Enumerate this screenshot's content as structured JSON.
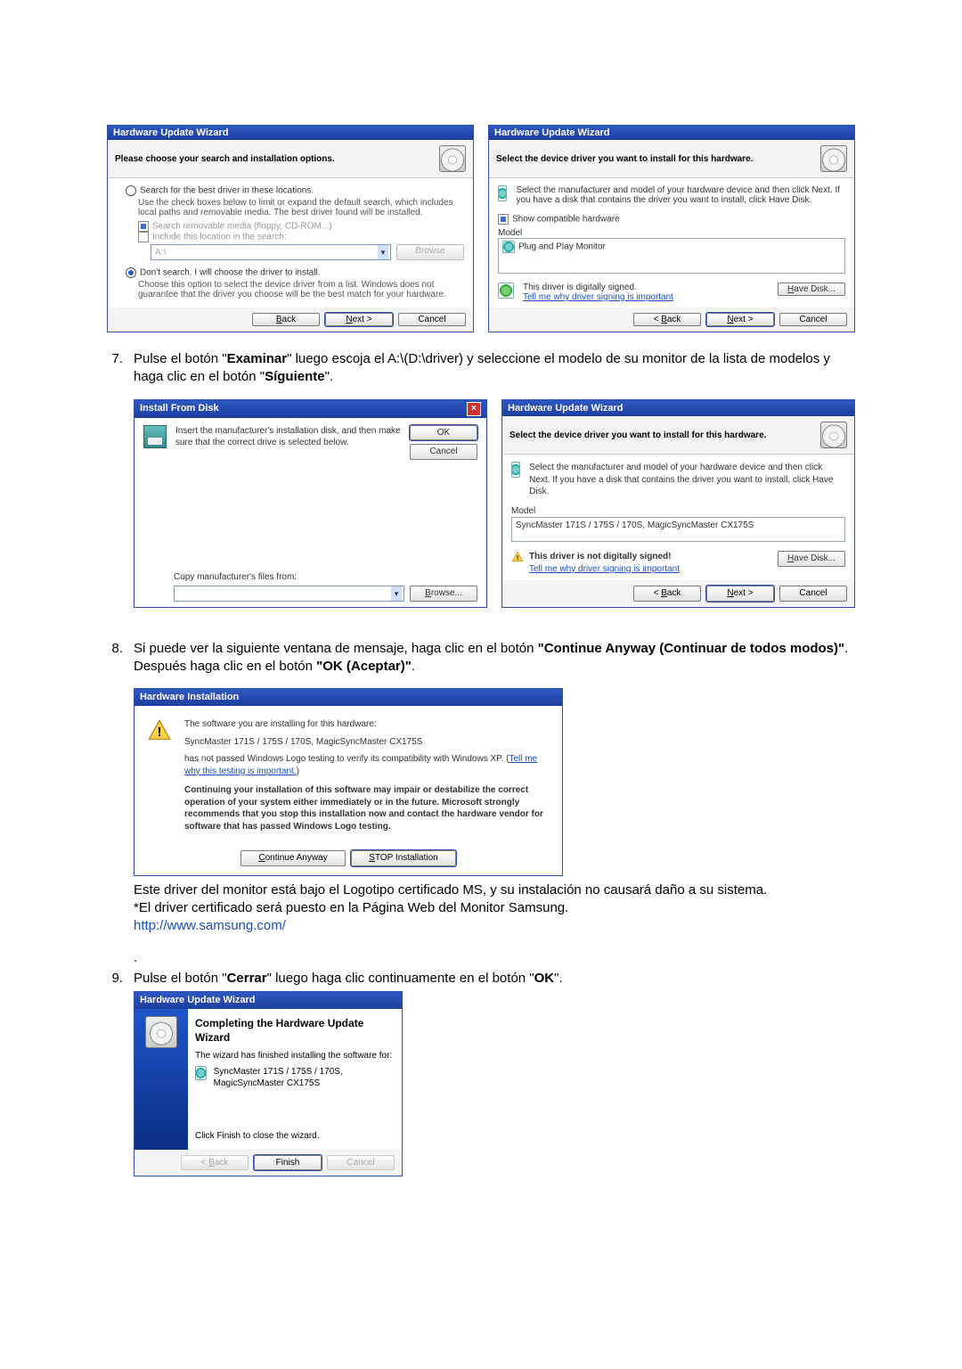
{
  "wizard_title": "Hardware Update Wizard",
  "install_from_disk_title": "Install From Disk",
  "hw_installation_title": "Hardware Installation",
  "search_header": "Please choose your search and installation options.",
  "search_radio1": "Search for the best driver in these locations.",
  "search_desc": "Use the check boxes below to limit or expand the default search, which includes local paths and removable media. The best driver found will be installed.",
  "search_chk1": "Search removable media (floppy, CD-ROM...)",
  "search_chk2": "Include this location in the search:",
  "search_path": "A:\\",
  "search_radio2": "Don't search. I will choose the driver to install.",
  "search_desc2": "Choose this option to select the device driver from a list.  Windows does not guarantee that the driver you choose will be the best match for your hardware.",
  "select_header": "Select the device driver you want to install for this hardware.",
  "select_desc": "Select the manufacturer and model of your hardware device and then click Next. If you have a disk that contains the driver you want to install, click Have Disk.",
  "show_compat": "Show compatible hardware",
  "model_label": "Model",
  "model_pnp": "Plug and Play Monitor",
  "signed_text": "This driver is digitally signed.",
  "unsigned_text": "This driver is not digitally signed!",
  "tell_me_why": "Tell me why driver signing is important",
  "model_sync": "SyncMaster 171S / 175S / 170S, MagicSyncMaster CX175S",
  "ifd_insert": "Insert the manufacturer's installation disk, and then make sure that the correct drive is selected below.",
  "ifd_copy": "Copy manufacturer's files from:",
  "btn_back": "< Back",
  "btn_next": "Next >",
  "btn_cancel": "Cancel",
  "btn_ok": "OK",
  "btn_browse": "Browse...",
  "btn_browse_u": "Browse",
  "btn_have_disk": "Have Disk...",
  "btn_finish": "Finish",
  "btn_continue_anyway": "Continue Anyway",
  "btn_stop_install": "STOP Installation",
  "step7_pre": "Pulse el botón \"",
  "step7_b1": "Examinar",
  "step7_mid": "\" luego escoja el A:\\(D:\\driver) y seleccione el modelo de su monitor de la lista de modelos y haga clic en el botón \"",
  "step7_b2": "Síguiente",
  "step7_post": "\".",
  "num7": "7.",
  "step8_pre": "Si puede ver la siguiente ventana de mensaje, haga clic en el botón ",
  "step8_b1": "\"Continue Anyway (Continuar de todos modos)\"",
  "step8_mid": ". Después haga clic en el botón ",
  "step8_b2": "\"OK (Aceptar)\"",
  "step8_post": ".",
  "num8": "8.",
  "hw_install_intro": "The software you are installing for this hardware:",
  "hw_install_model": "SyncMaster 171S / 175S / 170S, MagicSyncMaster CX175S",
  "hw_install_logo1": "has not passed Windows Logo testing to verify its compatibility with Windows XP. (",
  "hw_install_logo_link": "Tell me why this testing is important.",
  "hw_install_logo2": ")",
  "hw_install_warn": "Continuing your installation of this software may impair or destabilize the correct operation of your system either immediately or in the future. Microsoft strongly recommends that you stop this installation now and contact the hardware vendor for software that has passed Windows Logo testing.",
  "post8_line1": "Este driver del monitor está bajo el Logotipo certificado MS, y su instalación no causará daño a su sistema.",
  "post8_line2": "*El driver certificado será puesto en la Página Web del Monitor Samsung.",
  "post8_url": "http://www.samsung.com/",
  "step9_dot": ".",
  "num9": "9.",
  "step9_pre": "Pulse el botón \"",
  "step9_b1": "Cerrar",
  "step9_mid": "\" luego haga clic continuamente en el botón \"",
  "step9_b2": "OK",
  "step9_post": "\".",
  "complete_title": "Completing the Hardware Update Wizard",
  "complete_line1": "The wizard has finished installing the software for:",
  "complete_model": "SyncMaster 171S / 175S / 170S, MagicSyncMaster CX175S",
  "complete_close": "Click Finish to close the wizard."
}
